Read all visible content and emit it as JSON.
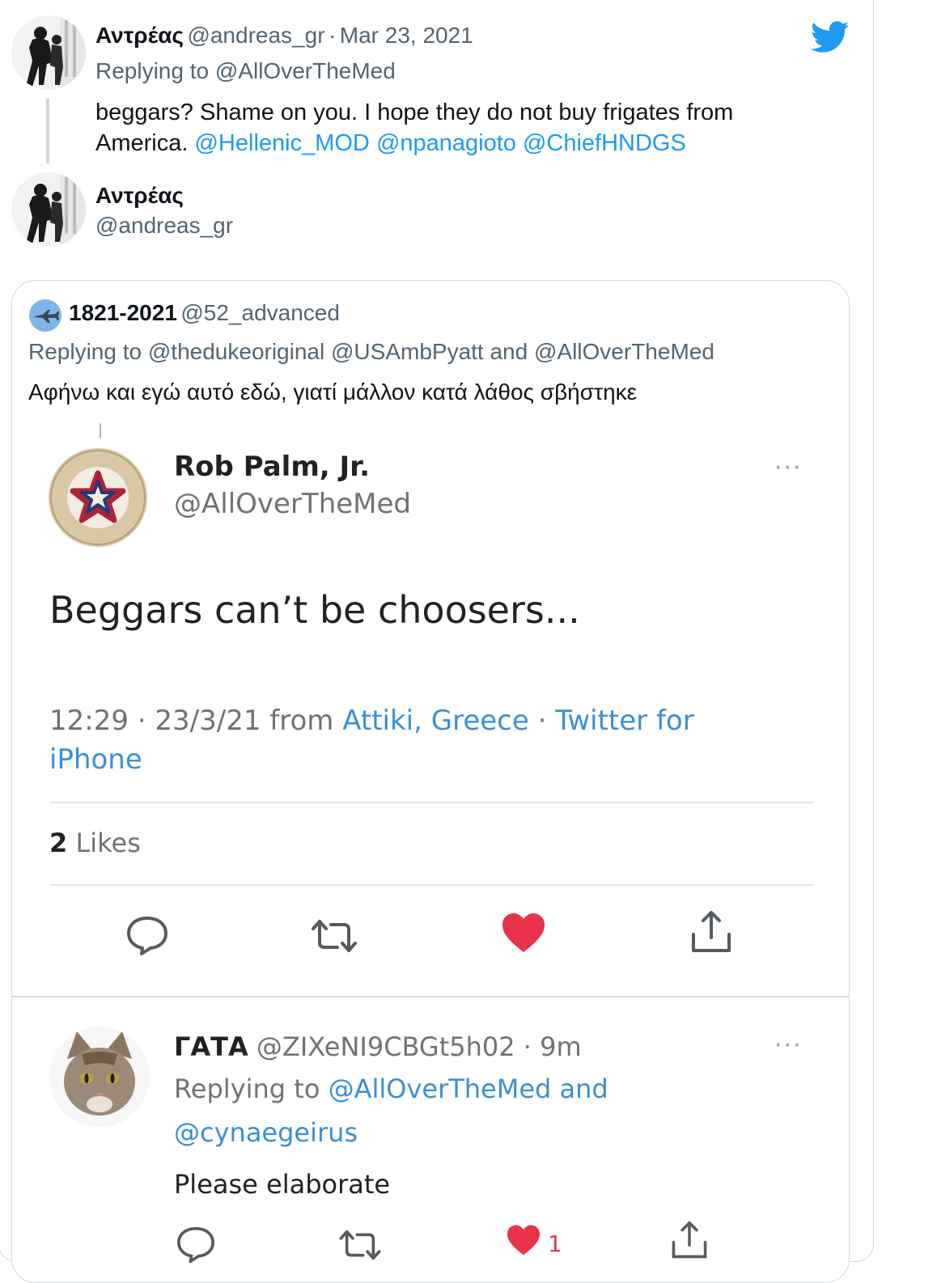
{
  "reply": {
    "name": "Αντρέας",
    "handle": "@andreas_gr",
    "separator": "·",
    "date": "Mar 23, 2021",
    "replying_prefix": "Replying to",
    "replying_to": "@AllOverTheMed",
    "text_line1": "beggars? Shame on you. I hope they do not buy frigates from",
    "text_line2_plain": "America.",
    "mentions": [
      "@Hellenic_MOD",
      "@npanagioto",
      "@ChiefHNDGS"
    ]
  },
  "main_tweet": {
    "name": "Αντρέας",
    "handle": "@andreas_gr"
  },
  "quoted": {
    "name": "1821-2021",
    "handle": "@52_advanced",
    "replying_prefix": "Replying to",
    "replying_to_1": "@thedukeoriginal",
    "replying_to_2": "@USAmbPyatt",
    "and_word": "and",
    "replying_to_3": "@AllOverTheMed",
    "text": "Αφήνω και εγώ αυτό εδώ, γιατί μάλλον κατά λάθος σβήστηκε"
  },
  "screenshot": {
    "tick": "|",
    "logo_text": "AMERICAN REVOLUTION BICENTENNIAL 1776-1976",
    "name": "Rob Palm, Jr.",
    "handle": "@AllOverTheMed",
    "more": "···",
    "tweet_text": "Beggars can’t be choosers...",
    "time": "12:29 · 23/3/21 from ",
    "location": "Attiki, Greece",
    "dot": " · ",
    "source_line1": "Twitter for",
    "source_line2": "iPhone",
    "likes_count": "2",
    "likes_label": "Likes",
    "reply": {
      "name": "ΓΑΤΑ",
      "handle": "@ZIXeNI9CBGt5h02",
      "time": "· 9m",
      "more": "···",
      "replying_prefix": "Replying to",
      "replying_to_1": "@AllOverTheMed and",
      "replying_to_2": "@cynaegeirus",
      "text": "Please elaborate",
      "like_count": "1"
    }
  },
  "colors": {
    "twitter_blue": "#1d9bf0",
    "heart_red": "#e8334a",
    "muted": "#536471"
  }
}
